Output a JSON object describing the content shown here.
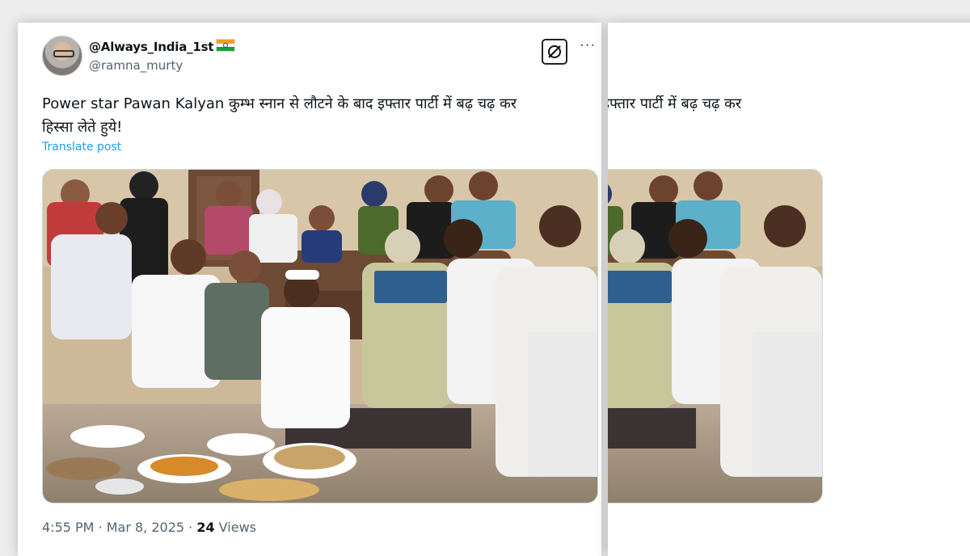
{
  "tweet": {
    "display_name": "@Always_India_1st",
    "flag_emoji": "indian-flag",
    "handle": "@ramna_murty",
    "text_line1": "Power star Pawan Kalyan कुम्भ स्नान से लौटने के बाद इफ्तार पार्टी में बढ़ चढ़ कर",
    "text_line2": "हिस्सा लेते हुये!",
    "translate_label": "Translate post",
    "more_icon": "ellipsis-icon",
    "grok_icon": "grok-icon",
    "timestamp": "4:55 PM · Mar 8, 2025 · ",
    "views_count": "24",
    "views_label": " Views"
  },
  "colors": {
    "text_primary": "#0f1419",
    "text_secondary": "#536471",
    "link": "#1d9bf0",
    "background": "#ededed",
    "card": "#ffffff"
  }
}
